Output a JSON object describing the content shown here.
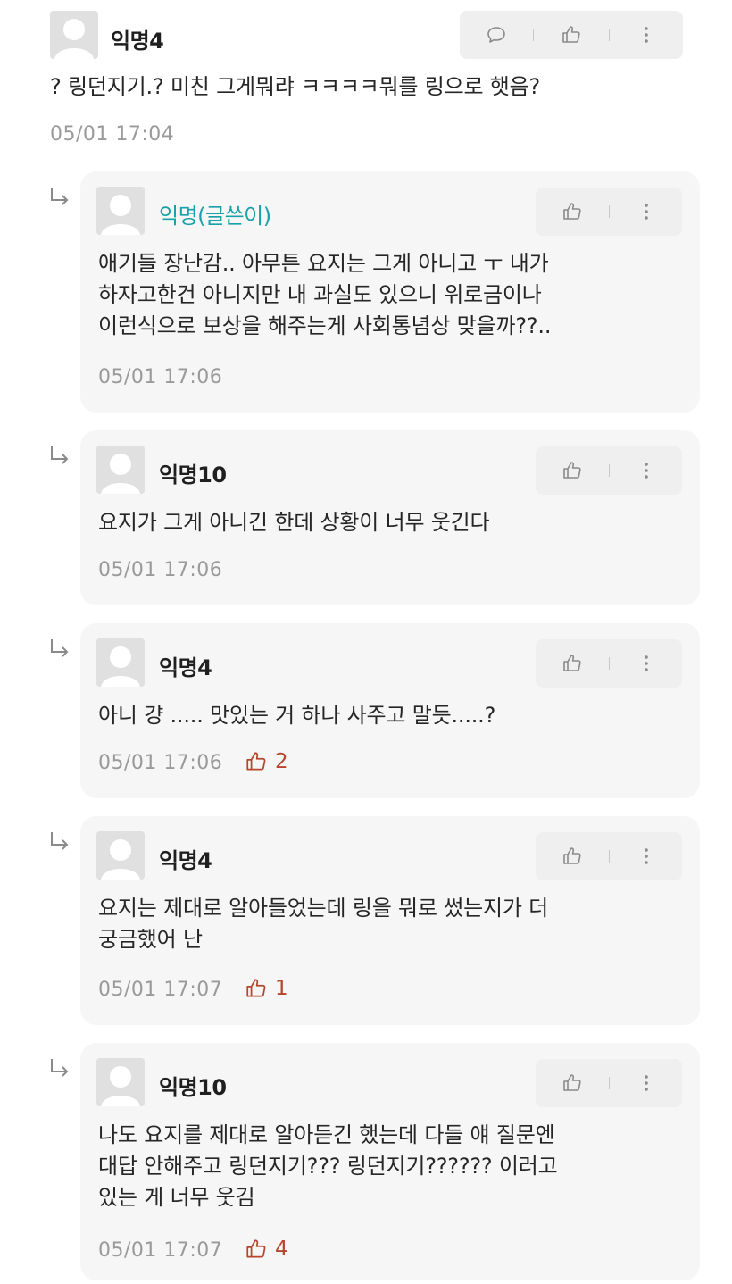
{
  "comments": [
    {
      "nick": "익명4",
      "author": false,
      "lines": [
        "? 링던지기.? 미친 그게뭐랴 ㅋㅋㅋㅋ뭐를 링으로 햇음?"
      ],
      "time": "05/01 17:04",
      "likes": ""
    },
    {
      "nick": "익명(글쓴이)",
      "author": true,
      "lines": [
        "애기들 장난감.. 아무튼 요지는 그게 아니고 ㅜ 내가",
        "하자고한건 아니지만 내 과실도 있으니 위로금이나",
        "이런식으로 보상을 해주는게 사회통념상 맞을까??.."
      ],
      "time": "05/01 17:06",
      "likes": ""
    },
    {
      "nick": "익명10",
      "author": false,
      "lines": [
        "요지가 그게 아니긴 한데 상황이 너무 웃긴다"
      ],
      "time": "05/01 17:06",
      "likes": ""
    },
    {
      "nick": "익명4",
      "author": false,
      "lines": [
        "아니 걍 ..... 맛있는 거 하나 사주고 말듯.....?"
      ],
      "time": "05/01 17:06",
      "likes": "2"
    },
    {
      "nick": "익명4",
      "author": false,
      "lines": [
        "요지는 제대로 알아들었는데 링을 뭐로 썼는지가 더",
        "궁금했어 난"
      ],
      "time": "05/01 17:07",
      "likes": "1"
    },
    {
      "nick": "익명10",
      "author": false,
      "lines": [
        "나도 요지를 제대로 알아듣긴 했는데 다들 얘 질문엔",
        "대답 안해주고 링던지기??? 링던지기?????? 이러고",
        "있는 게 너무 웃김"
      ],
      "time": "05/01 17:07",
      "likes": "4"
    }
  ],
  "icons": {
    "reply": "speech-bubble-icon",
    "like": "thumbs-up-icon",
    "more": "vertical-dots-icon",
    "reply_arrow": "reply-arrow-icon",
    "avatar": "default-avatar-icon"
  },
  "colors": {
    "author_nick": "#1aa0a8",
    "like_count": "#b5452c",
    "card_bg": "#f6f6f6"
  }
}
